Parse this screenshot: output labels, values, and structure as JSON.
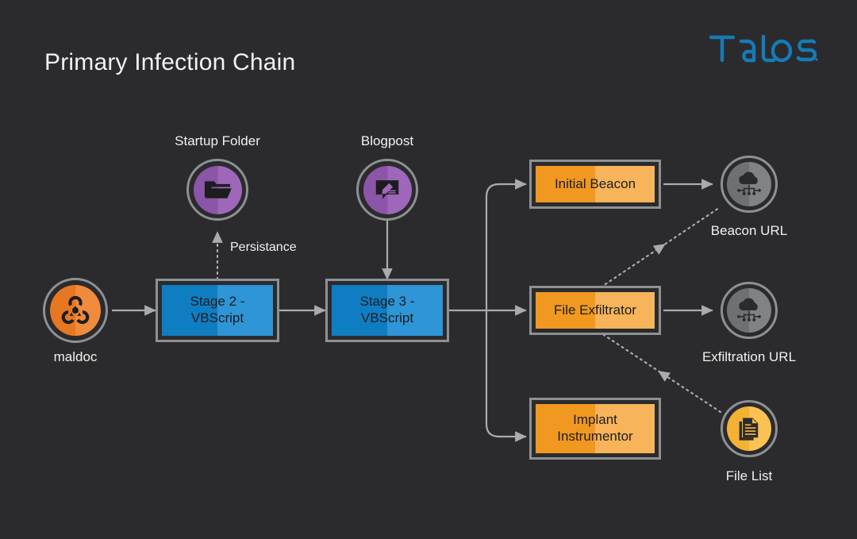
{
  "page": {
    "title": "Primary Infection Chain",
    "background_color": "#2b2b2d",
    "brand": {
      "name": "Talos",
      "color": "#157bb8"
    }
  },
  "palette": {
    "blue_dark": "#0f7dc2",
    "blue_light": "#2e95d6",
    "orange_dark": "#f0981f",
    "orange_light": "#f7b45b",
    "purple": "#9f67ba",
    "maldoc_orange": "#e87722",
    "gray_node": "#7a7d80",
    "amber": "#f4b233",
    "border_gray": "#8e9194",
    "text_light": "#f0f0f0",
    "text_dark": "#1d1d1f"
  },
  "nodes": {
    "maldoc": {
      "label": "maldoc",
      "icon": "biohazard-icon",
      "shape": "circle",
      "color": "#e87722"
    },
    "startup_folder": {
      "label": "Startup Folder",
      "icon": "folder-open-icon",
      "shape": "circle",
      "color": "#9f67ba"
    },
    "blogpost": {
      "label": "Blogpost",
      "icon": "blogpost-pencil-icon",
      "shape": "circle",
      "color": "#9f67ba"
    },
    "stage2": {
      "label": "Stage 2 -\nVBScript",
      "line1": "Stage 2 -",
      "line2": "VBScript",
      "shape": "box",
      "color": "#0f7dc2"
    },
    "stage3": {
      "label": "Stage 3 -\nVBScript",
      "line1": "Stage 3 -",
      "line2": "VBScript",
      "shape": "box",
      "color": "#0f7dc2"
    },
    "initial_beacon": {
      "label": "Initial Beacon",
      "shape": "box",
      "color": "#f0981f"
    },
    "file_exfiltrator": {
      "label": "File Exfiltrator",
      "shape": "box",
      "color": "#f0981f"
    },
    "implant_instrumentor": {
      "line1": "Implant",
      "line2": "Instrumentor",
      "label": "Implant Instrumentor",
      "shape": "box",
      "color": "#f0981f"
    },
    "beacon_url": {
      "label": "Beacon URL",
      "icon": "cloud-network-icon",
      "shape": "circle",
      "color": "#7a7d80"
    },
    "exfiltration_url": {
      "label": "Exfiltration URL",
      "icon": "cloud-network-icon",
      "shape": "circle",
      "color": "#7a7d80"
    },
    "file_list": {
      "label": "File List",
      "icon": "file-list-icon",
      "shape": "circle",
      "color": "#f4b233"
    }
  },
  "edges": {
    "persistance": {
      "label": "Persistance",
      "style": "dotted",
      "from": "stage2",
      "to": "startup_folder"
    },
    "maldoc_to_stage2": {
      "label": "",
      "style": "solid",
      "from": "maldoc",
      "to": "stage2"
    },
    "stage2_to_stage3": {
      "label": "",
      "style": "solid",
      "from": "stage2",
      "to": "stage3"
    },
    "blogpost_to_stage3": {
      "label": "",
      "style": "solid",
      "from": "blogpost",
      "to": "stage3"
    },
    "stage3_to_initial_beacon": {
      "label": "",
      "style": "solid",
      "from": "stage3",
      "to": "initial_beacon"
    },
    "stage3_to_file_exfiltrator": {
      "label": "",
      "style": "solid",
      "from": "stage3",
      "to": "file_exfiltrator"
    },
    "stage3_to_implant_instrumentor": {
      "label": "",
      "style": "solid",
      "from": "stage3",
      "to": "implant_instrumentor"
    },
    "initial_beacon_to_beacon_url": {
      "label": "",
      "style": "solid",
      "from": "initial_beacon",
      "to": "beacon_url"
    },
    "file_exfiltrator_to_exfiltration_url": {
      "label": "",
      "style": "solid",
      "from": "file_exfiltrator",
      "to": "exfiltration_url"
    },
    "file_exfiltrator_to_beacon_url": {
      "label": "",
      "style": "dotted",
      "from": "file_exfiltrator",
      "to": "beacon_url"
    },
    "file_list_to_file_exfiltrator": {
      "label": "",
      "style": "dotted",
      "from": "file_list",
      "to": "file_exfiltrator"
    }
  }
}
